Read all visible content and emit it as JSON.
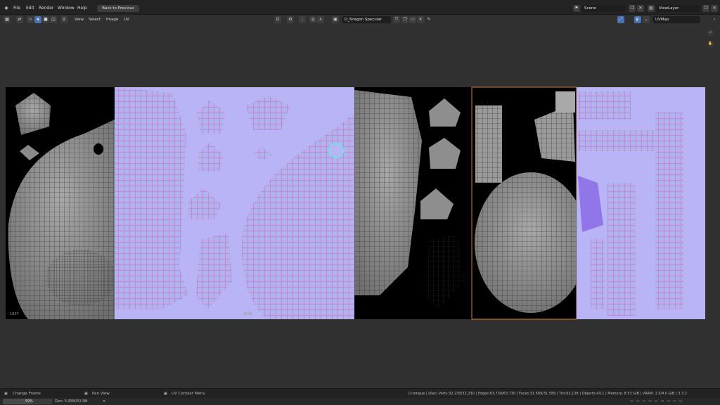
{
  "menu": {
    "file": "File",
    "edit": "Edit",
    "render": "Render",
    "window": "Window",
    "help": "Help",
    "back_to_previous": "Back to Previous"
  },
  "scene": {
    "name": "Scene"
  },
  "view_layer": {
    "name": "ViewLayer"
  },
  "header": {
    "view": "View",
    "select": "Select",
    "image": "Image",
    "uv": "UV",
    "image_name": "D_Nragon Specular",
    "uv_map": "UVMap"
  },
  "tiles": {
    "label_1007": "1007",
    "label_1008": "1008"
  },
  "status": {
    "change_frame": "Change Frame",
    "pan_view": "Pan View",
    "uv_context_menu": "UV Context Menu",
    "stats": "D-tongue | (Key) Verts:32,230/32,230 | Edges:63,730/63,730 | Faces:31,589/31,589 | Tris:63,138 | Objects:4/11 | Memory: 8.53 GiB | VRAM: 1.5/4.0 GiB | 3.3.2"
  },
  "bottom": {
    "progress_label": "59%",
    "progress_value": 0.59,
    "disk": "Disc: 5.95M/50.9M"
  },
  "colors": {
    "normal_map": "#b9b4f6",
    "selection_border": "#e07b2a",
    "ui_dark": "#303030"
  }
}
